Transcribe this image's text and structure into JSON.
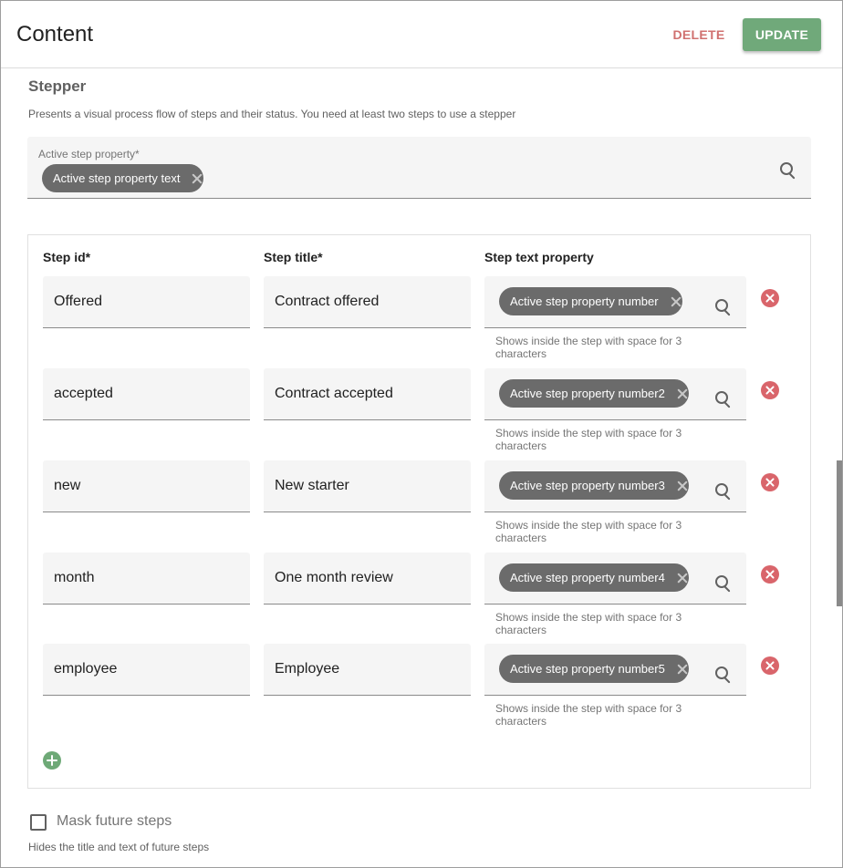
{
  "header": {
    "title": "Content",
    "delete_label": "DELETE",
    "update_label": "UPDATE"
  },
  "stepper": {
    "title": "Stepper",
    "description": "Presents a visual process flow of steps and their status. You need at least two steps to use a stepper",
    "active_step": {
      "label": "Active step property*",
      "chip": "Active step property text",
      "chip_remove_icon": "close-icon",
      "search_icon": "search-icon"
    },
    "columns": {
      "id": "Step id*",
      "title": "Step title*",
      "text_property": "Step text property"
    },
    "steps": [
      {
        "id": "Offered",
        "title": "Contract offered",
        "chip": "Active step property number",
        "helper": "Shows inside the step with space for 3 characters"
      },
      {
        "id": "accepted",
        "title": "Contract accepted",
        "chip": "Active step property number2",
        "helper": "Shows inside the step with space for 3 characters"
      },
      {
        "id": "new",
        "title": "New starter",
        "chip": "Active step property number3",
        "helper": "Shows inside the step with space for 3 characters"
      },
      {
        "id": "month",
        "title": "One month review",
        "chip": "Active step property number4",
        "helper": "Shows inside the step with space for 3 characters"
      },
      {
        "id": "employee",
        "title": "Employee",
        "chip": "Active step property number5",
        "helper": "Shows inside the step with space for 3 characters"
      }
    ],
    "add_icon": "add-circle-icon",
    "remove_icon": "remove-circle-icon"
  },
  "mask": {
    "label": "Mask future steps",
    "checked": false,
    "helper": "Hides the title and text of future steps"
  },
  "colors": {
    "primary": "#70a97a",
    "danger": "#d9656b",
    "delete_text": "#d0706f",
    "chip": "#6b6b6b",
    "field_bg": "#f5f5f5"
  }
}
